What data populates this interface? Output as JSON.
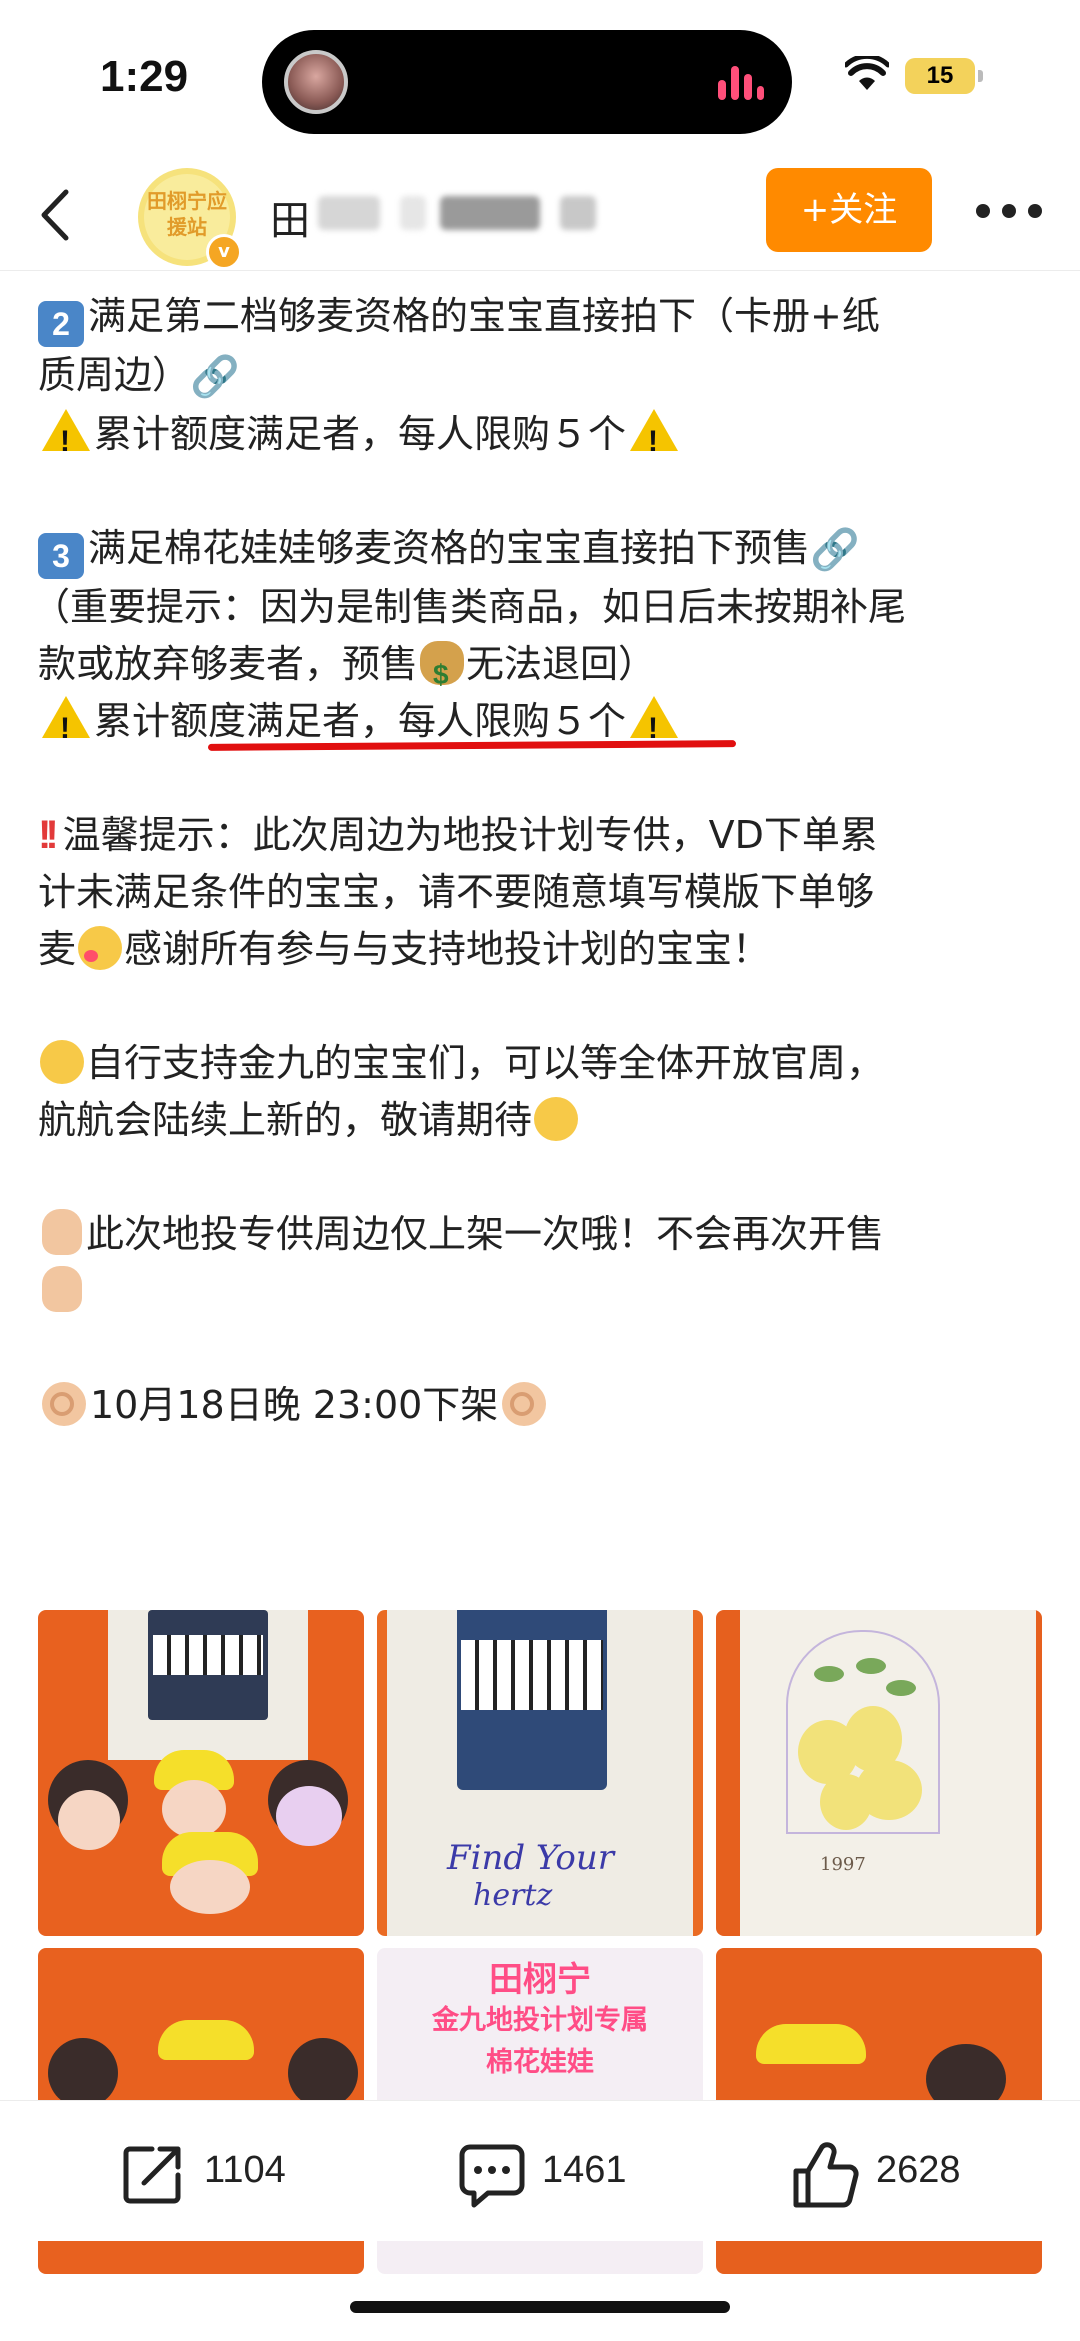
{
  "status_bar": {
    "time": "1:29",
    "battery": "15"
  },
  "nav": {
    "username_visible": "田",
    "follow_label": "+关注",
    "avatar_text": "田栩宁应援站"
  },
  "post": {
    "p1_line1": "满足第二档够麦资格的宝宝直接拍下（卡册+纸",
    "p1_line2": "质周边）",
    "p1_badge": "2",
    "p1_limit": "累计额度满足者，每人限购５个",
    "p2_badge": "3",
    "p2_line1": "满足棉花娃娃够麦资格的宝宝直接拍下预售",
    "p2_line2": "（重要提示：因为是制售类商品，如日后未按期补尾",
    "p2_line3a": "款或放弃够麦者，预售",
    "p2_line3b": "无法退回）",
    "p2_limit": "累计额度满足者，每人限购５个",
    "p3_line1": "温馨提示：此次周边为地投计划专供，VD下单累",
    "p3_line2": "计未满足条件的宝宝，请不要随意填写模版下单够",
    "p3_line3a": "麦",
    "p3_line3b": "感谢所有参与与支持地投计划的宝宝！",
    "p4_line1": "自行支持金九的宝宝们，可以等全体开放官周，",
    "p4_line2": "航航会陆续上新的，敬请期待",
    "p5_line1": "此次地投专供周边仅上架一次哦！不会再次开售",
    "p6_line1": "10月18日晚 23:00下架"
  },
  "images": {
    "tile2_text1": "Find Your",
    "tile2_text2": "hertz",
    "tile3_year": "1997",
    "tile5_line1": "田栩宁",
    "tile5_line2": "金九地投计划专属",
    "tile5_line3": "棉花娃娃"
  },
  "actions": {
    "share_count": "1104",
    "comment_count": "1461",
    "like_count": "2628"
  },
  "colors": {
    "follow": "#ff8a00",
    "underline": "#e10f0f",
    "keycap_blue": "#4a86c8"
  }
}
